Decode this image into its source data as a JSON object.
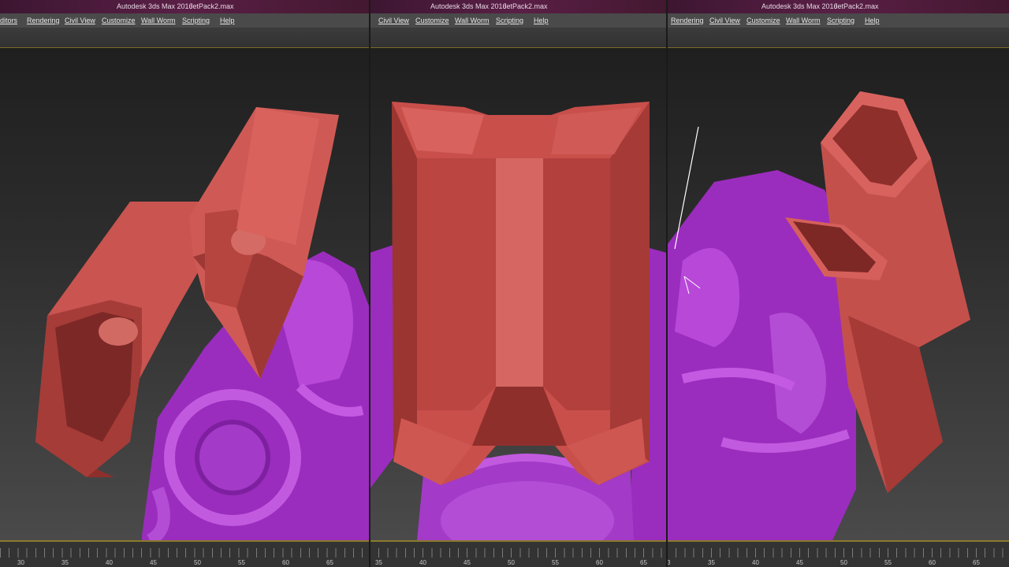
{
  "app_title": "Autodesk 3ds Max 2016",
  "file_name": "JetPack2.max",
  "panels": [
    {
      "menu": [
        "ditors",
        "Rendering",
        "Civil View",
        "Customize",
        "Wall Worm",
        "Scripting",
        "Help"
      ],
      "ticks": [
        "30",
        "35",
        "40",
        "45",
        "50",
        "55",
        "60",
        "65"
      ]
    },
    {
      "menu": [
        "Civil View",
        "Customize",
        "Wall Worm",
        "Scripting",
        "Help"
      ],
      "ticks": [
        "35",
        "40",
        "45",
        "50",
        "55",
        "60",
        "65"
      ]
    },
    {
      "menu": [
        "Rendering",
        "Civil View",
        "Customize",
        "Wall Worm",
        "Scripting",
        "Help"
      ],
      "ticks": [
        "3",
        "35",
        "40",
        "45",
        "50",
        "55",
        "60",
        "65"
      ]
    }
  ],
  "colors": {
    "model_red": "#cf5a55",
    "model_purple": "#a02fc4",
    "viewport_bg": "#2d2d2d",
    "title_bg": "#5a1f46"
  }
}
